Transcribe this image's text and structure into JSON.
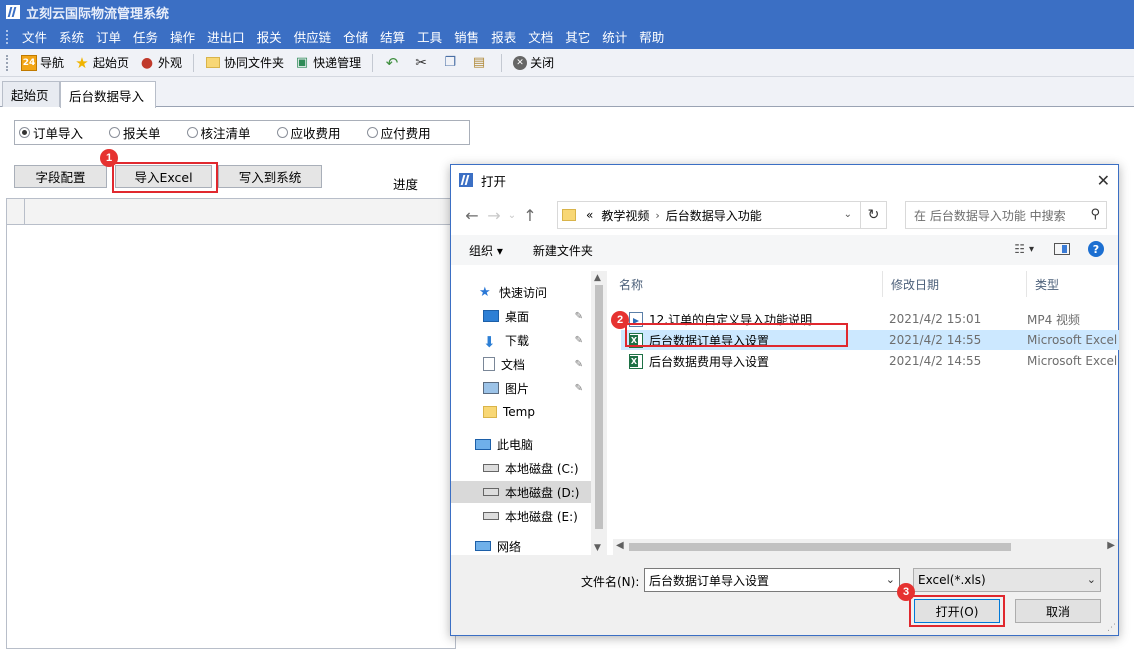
{
  "app": {
    "title": "立刻云国际物流管理系统"
  },
  "menu": [
    "文件",
    "系统",
    "订单",
    "任务",
    "操作",
    "进出口",
    "报关",
    "供应链",
    "仓储",
    "结算",
    "工具",
    "销售",
    "报表",
    "文档",
    "其它",
    "统计",
    "帮助"
  ],
  "toolbar": {
    "nav": "导航",
    "start": "起始页",
    "appearance": "外观",
    "shared_folder": "协同文件夹",
    "express": "快递管理",
    "close": "关闭"
  },
  "tabs": {
    "start": "起始页",
    "import": "后台数据导入"
  },
  "radios": [
    {
      "label": "订单导入",
      "checked": true
    },
    {
      "label": "报关单",
      "checked": false
    },
    {
      "label": "核注清单",
      "checked": false
    },
    {
      "label": "应收费用",
      "checked": false
    },
    {
      "label": "应付费用",
      "checked": false
    }
  ],
  "buttons": {
    "field_config": "字段配置",
    "import_excel": "导入Excel",
    "write_system": "写入到系统"
  },
  "progress_label": "进度",
  "annotations": [
    "1",
    "2",
    "3"
  ],
  "dialog": {
    "title": "打开",
    "breadcrumb": [
      "«",
      "教学视频",
      "后台数据导入功能"
    ],
    "search_placeholder": "在 后台数据导入功能 中搜索",
    "organize": "组织 ▾",
    "new_folder": "新建文件夹",
    "nav": {
      "quick_access": "快速访问",
      "desktop": "桌面",
      "downloads": "下载",
      "documents": "文档",
      "pictures": "图片",
      "temp": "Temp",
      "this_pc": "此电脑",
      "disk_c": "本地磁盘 (C:)",
      "disk_d": "本地磁盘 (D:)",
      "disk_e": "本地磁盘 (E:)",
      "network": "网络"
    },
    "columns": {
      "name": "名称",
      "date": "修改日期",
      "type": "类型"
    },
    "files": [
      {
        "name": "12.订单的自定义导入功能说明",
        "date": "2021/4/2 15:01",
        "type": "MP4 视频"
      },
      {
        "name": "后台数据订单导入设置",
        "date": "2021/4/2 14:55",
        "type": "Microsoft Excel"
      },
      {
        "name": "后台数据费用导入设置",
        "date": "2021/4/2 14:55",
        "type": "Microsoft Excel"
      }
    ],
    "filename_label": "文件名(N):",
    "filename_value": "后台数据订单导入设置",
    "filetype": "Excel(*.xls)",
    "open_button": "打开(O)",
    "cancel_button": "取消"
  }
}
